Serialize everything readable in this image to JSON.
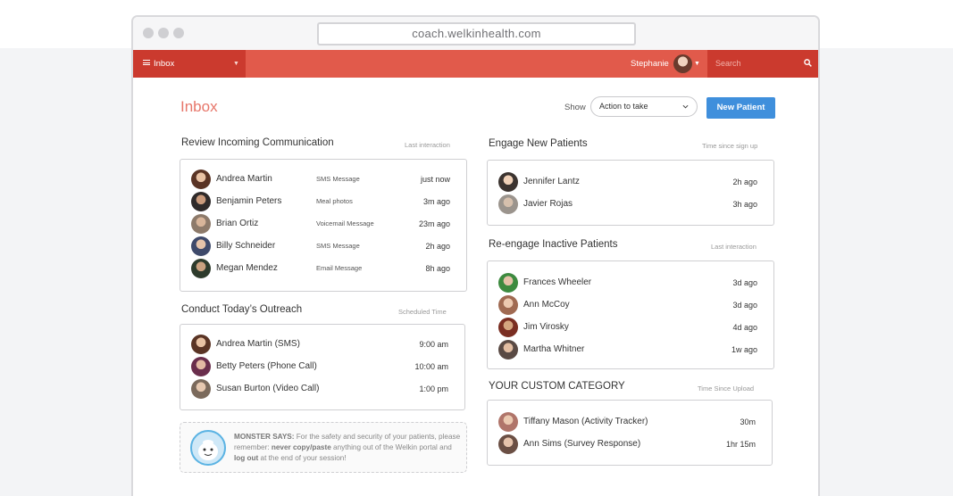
{
  "browser": {
    "url": "coach.welkinhealth.com"
  },
  "navbar": {
    "inbox_label": "Inbox",
    "user_name": "Stephanie",
    "search_placeholder": "Search"
  },
  "header": {
    "title": "Inbox",
    "show_label": "Show",
    "show_selected": "Action to take",
    "new_patient_button": "New Patient"
  },
  "colors": {
    "brand_red": "#e15a4b",
    "brand_dark_red": "#cb3a2e",
    "accent_blue": "#3f8fdc"
  },
  "left": {
    "review": {
      "title": "Review Incoming Communication",
      "subtitle": "Last interaction",
      "rows": [
        {
          "name": "Andrea Martin",
          "type": "SMS Message",
          "time": "just now"
        },
        {
          "name": "Benjamin Peters",
          "type": "Meal photos",
          "time": "3m ago"
        },
        {
          "name": "Brian Ortiz",
          "type": "Voicemail Message",
          "time": "23m ago"
        },
        {
          "name": "Billy Schneider",
          "type": "SMS Message",
          "time": "2h ago"
        },
        {
          "name": "Megan Mendez",
          "type": "Email Message",
          "time": "8h ago"
        }
      ]
    },
    "outreach": {
      "title": "Conduct Today’s Outreach",
      "subtitle": "Scheduled Time",
      "rows": [
        {
          "name": "Andrea Martin (SMS)",
          "time": "9:00 am"
        },
        {
          "name": "Betty Peters (Phone Call)",
          "time": "10:00 am"
        },
        {
          "name": "Susan Burton (Video Call)",
          "time": "1:00 pm"
        }
      ]
    },
    "monster": {
      "label": "MONSTER SAYS:",
      "text1": " For the safety and security of your patients, please remember: ",
      "bold1": "never copy/paste",
      "text2": " anything out of the Welkin portal and ",
      "bold2": "log out",
      "text3": " at the end of your session!"
    }
  },
  "right": {
    "engage": {
      "title": "Engage New Patients",
      "subtitle": "Time since sign up",
      "rows": [
        {
          "name": "Jennifer Lantz",
          "time": "2h ago"
        },
        {
          "name": "Javier Rojas",
          "time": "3h ago"
        }
      ]
    },
    "reengage": {
      "title": "Re-engage Inactive Patients",
      "subtitle": "Last interaction",
      "rows": [
        {
          "name": "Frances Wheeler",
          "time": "3d ago"
        },
        {
          "name": "Ann McCoy",
          "time": "3d ago"
        },
        {
          "name": "Jim Virosky",
          "time": "4d ago"
        },
        {
          "name": "Martha Whitner",
          "time": "1w ago"
        }
      ]
    },
    "custom": {
      "title": "YOUR CUSTOM CATEGORY",
      "subtitle": "Time Since Upload",
      "rows": [
        {
          "name": "Tiffany Mason (Activity Tracker)",
          "time": "30m"
        },
        {
          "name": "Ann Sims (Survey Response)",
          "time": "1hr 15m"
        }
      ]
    }
  }
}
